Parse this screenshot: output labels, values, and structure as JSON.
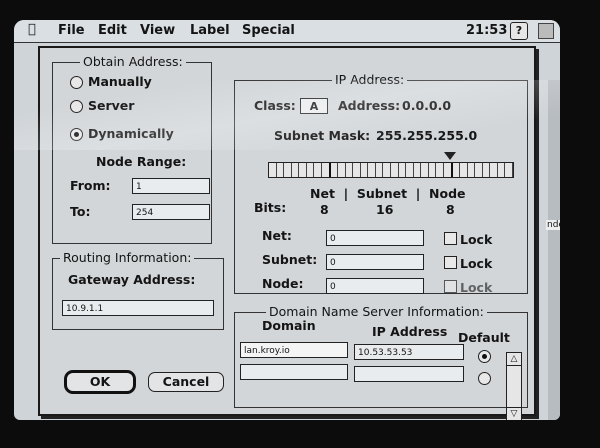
{
  "menubar": {
    "apple_icon": "apple-icon",
    "items": [
      "File",
      "Edit",
      "View",
      "Label",
      "Special"
    ],
    "clock": "21:53",
    "help_icon": "?"
  },
  "obtain": {
    "title": "Obtain Address:",
    "manually": "Manually",
    "server": "Server",
    "dynamically": "Dynamically",
    "selected": "dynamically",
    "node_range": "Node Range:",
    "from_label": "From:",
    "from_value": "1",
    "to_label": "To:",
    "to_value": "254"
  },
  "routing": {
    "title": "Routing Information:",
    "gateway_label": "Gateway Address:",
    "gateway_value": "10.9.1.1"
  },
  "ip": {
    "title": "IP Address:",
    "class_label": "Class:",
    "class_value": "A",
    "address_label": "Address:",
    "address_value": "0.0.0.0",
    "subnet_mask_label": "Subnet Mask:",
    "subnet_mask_value": "255.255.255.0",
    "header": "Net  |  Subnet  |  Node",
    "bits_label": "Bits:",
    "bits_net": "8",
    "bits_subnet": "16",
    "bits_node": "8",
    "net_label": "Net:",
    "net_value": "0",
    "subnet_label": "Subnet:",
    "subnet_value": "0",
    "node_label": "Node:",
    "node_value": "0",
    "lock_label": "Lock"
  },
  "dns": {
    "title": "Domain Name Server Information:",
    "col_domain": "Domain",
    "col_ip": "IP Address",
    "col_default": "Default",
    "rows": [
      {
        "domain": "lan.kroy.io",
        "ip": "10.53.53.53",
        "default": true
      },
      {
        "domain": "",
        "ip": "",
        "default": false
      }
    ]
  },
  "buttons": {
    "ok": "OK",
    "cancel": "Cancel"
  },
  "desktop": {
    "fragment_label": "nder"
  }
}
